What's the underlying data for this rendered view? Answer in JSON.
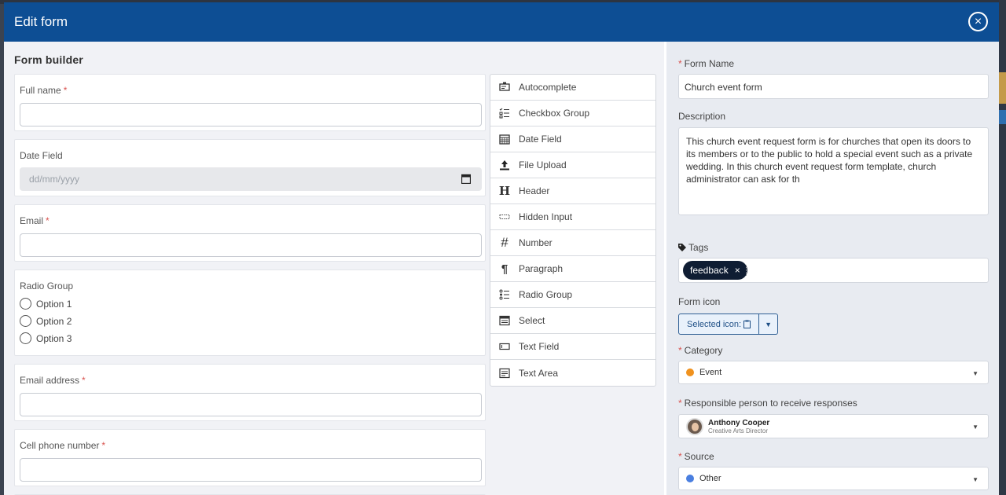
{
  "modal": {
    "title": "Edit form",
    "close_glyph": "×"
  },
  "builder": {
    "title": "Form builder",
    "fields": {
      "full_name": {
        "label": "Full name",
        "required": "*"
      },
      "date": {
        "label": "Date Field",
        "placeholder": "dd/mm/yyyy"
      },
      "email": {
        "label": "Email",
        "required": "*"
      },
      "radio": {
        "label": "Radio Group",
        "options": [
          "Option 1",
          "Option 2",
          "Option 3"
        ]
      },
      "email_address": {
        "label": "Email address",
        "required": "*"
      },
      "cell_phone": {
        "label": "Cell phone number",
        "required": "*"
      }
    }
  },
  "palette": {
    "items": [
      {
        "label": "Autocomplete",
        "icon": "autocomplete-icon"
      },
      {
        "label": "Checkbox Group",
        "icon": "checkbox-group-icon"
      },
      {
        "label": "Date Field",
        "icon": "calendar-icon"
      },
      {
        "label": "File Upload",
        "icon": "upload-icon"
      },
      {
        "label": "Header",
        "icon": "header-icon"
      },
      {
        "label": "Hidden Input",
        "icon": "hidden-input-icon"
      },
      {
        "label": "Number",
        "icon": "hash-icon"
      },
      {
        "label": "Paragraph",
        "icon": "paragraph-icon"
      },
      {
        "label": "Radio Group",
        "icon": "radio-group-icon"
      },
      {
        "label": "Select",
        "icon": "select-icon"
      },
      {
        "label": "Text Field",
        "icon": "text-field-icon"
      },
      {
        "label": "Text Area",
        "icon": "text-area-icon"
      }
    ]
  },
  "settings": {
    "form_name": {
      "label": "Form Name",
      "required": "*",
      "value": "Church event form"
    },
    "description": {
      "label": "Description",
      "value": "This church event request form is for churches that open its doors to its members or to the public to hold a special event such as a private wedding. In this church event request form template, church administrator can ask for th"
    },
    "tags": {
      "label": "Tags",
      "items": [
        "feedback"
      ],
      "remove_glyph": "×"
    },
    "form_icon": {
      "label": "Form icon",
      "button_label": "Selected icon:"
    },
    "category": {
      "label": "Category",
      "required": "*",
      "value": "Event",
      "color": "#f0921e"
    },
    "responsible": {
      "label": "Responsible person to receive responses",
      "required": "*",
      "name": "Anthony Cooper",
      "role": "Creative Arts Director"
    },
    "source": {
      "label": "Source",
      "required": "*",
      "value": "Other",
      "color": "#4a7fe0"
    }
  },
  "colors": {
    "header": "#0d4e94",
    "required": "#d9534f",
    "tag": "#0f1d33"
  }
}
